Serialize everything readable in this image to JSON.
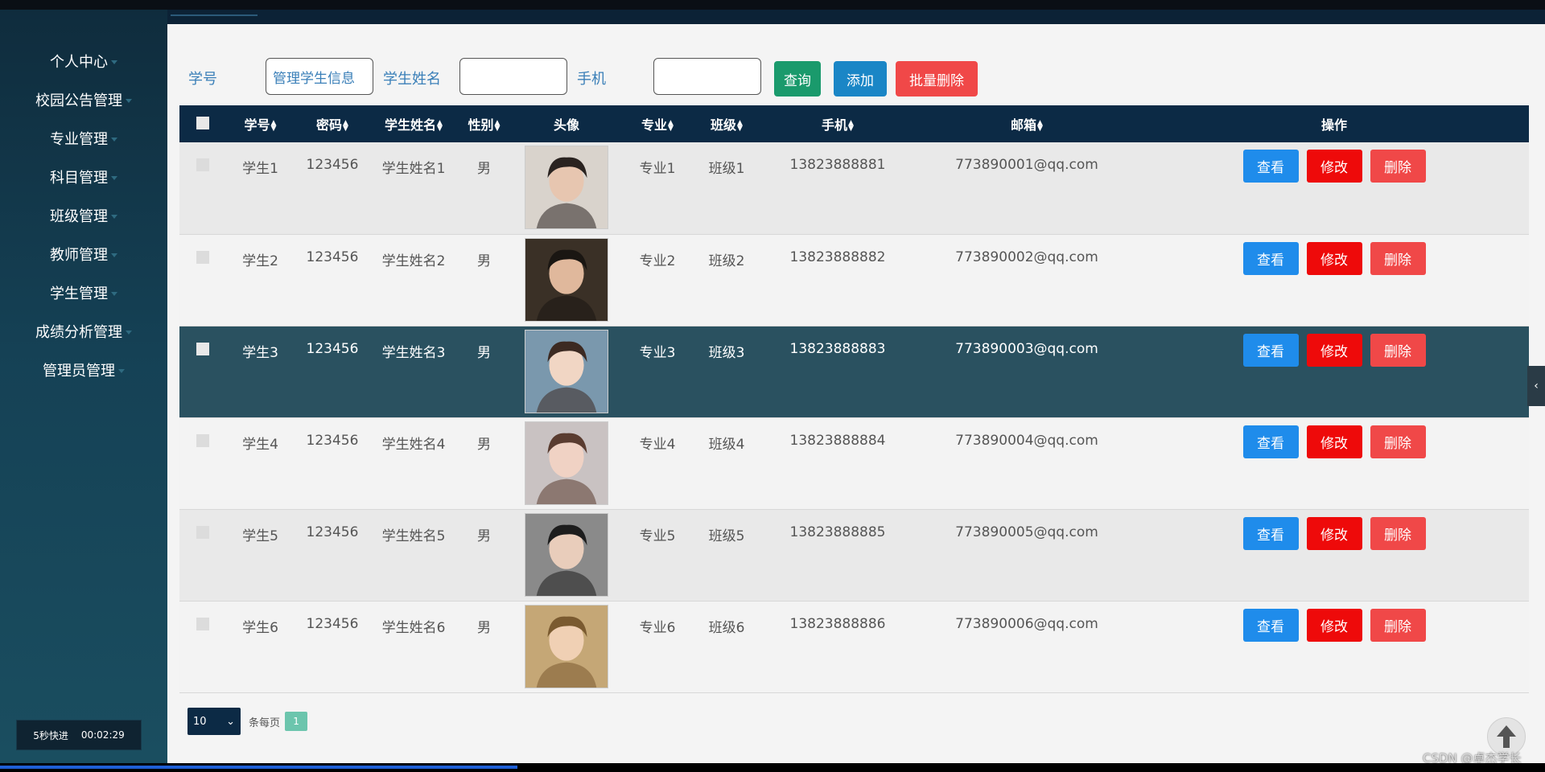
{
  "sidebar": {
    "items": [
      {
        "label": "个人中心"
      },
      {
        "label": "校园公告管理"
      },
      {
        "label": "专业管理"
      },
      {
        "label": "科目管理"
      },
      {
        "label": "班级管理"
      },
      {
        "label": "教师管理"
      },
      {
        "label": "学生管理"
      },
      {
        "label": "成绩分析管理"
      },
      {
        "label": "管理员管理"
      }
    ]
  },
  "timer": {
    "label": "5秒快进",
    "time": "00:02:29"
  },
  "search": {
    "id_label": "学号",
    "id_value": "管理学生信息",
    "name_label": "学生姓名",
    "name_value": "",
    "phone_label": "手机",
    "phone_value": "",
    "query_button": "查询",
    "add_button": "添加",
    "batch_delete_button": "批量删除"
  },
  "table": {
    "headers": {
      "id": "学号",
      "password": "密码",
      "name": "学生姓名",
      "gender": "性别",
      "avatar": "头像",
      "major": "专业",
      "class": "班级",
      "phone": "手机",
      "email": "邮箱",
      "actions": "操作"
    },
    "rows": [
      {
        "id": "学生1",
        "password": "123456",
        "name": "学生姓名1",
        "gender": "男",
        "major": "专业1",
        "class": "班级1",
        "phone": "13823888881",
        "email": "773890001@qq.com"
      },
      {
        "id": "学生2",
        "password": "123456",
        "name": "学生姓名2",
        "gender": "男",
        "major": "专业2",
        "class": "班级2",
        "phone": "13823888882",
        "email": "773890002@qq.com"
      },
      {
        "id": "学生3",
        "password": "123456",
        "name": "学生姓名3",
        "gender": "男",
        "major": "专业3",
        "class": "班级3",
        "phone": "13823888883",
        "email": "773890003@qq.com"
      },
      {
        "id": "学生4",
        "password": "123456",
        "name": "学生姓名4",
        "gender": "男",
        "major": "专业4",
        "class": "班级4",
        "phone": "13823888884",
        "email": "773890004@qq.com"
      },
      {
        "id": "学生5",
        "password": "123456",
        "name": "学生姓名5",
        "gender": "男",
        "major": "专业5",
        "class": "班级5",
        "phone": "13823888885",
        "email": "773890005@qq.com"
      },
      {
        "id": "学生6",
        "password": "123456",
        "name": "学生姓名6",
        "gender": "男",
        "major": "专业6",
        "class": "班级6",
        "phone": "13823888886",
        "email": "773890006@qq.com"
      }
    ],
    "action_labels": {
      "view": "查看",
      "edit": "修改",
      "delete": "删除"
    }
  },
  "pagination": {
    "page_size": "10",
    "per_page_text": "条每页",
    "current_page": "1"
  },
  "watermark": "CSDN @卓杰学长",
  "video_progress": 0.335,
  "colors": {
    "sidebar_bg": "#154155",
    "header_bg": "#0c2a45",
    "highlight_row": "#2a5160",
    "query_button": "#1a9a6c",
    "add_button": "#1a86c6",
    "batch_delete_button": "#f04848",
    "view_button": "#1f8ceb",
    "edit_button": "#ee0a0a",
    "delete_button": "#f04848",
    "page_number": "#6cc5ad"
  },
  "icons": {
    "sort": "sort-icon",
    "dropdown": "chevron-down-icon",
    "collapse": "chevron-left-icon",
    "back_to_top": "arrow-up-icon",
    "avatar": "avatar-photo"
  }
}
